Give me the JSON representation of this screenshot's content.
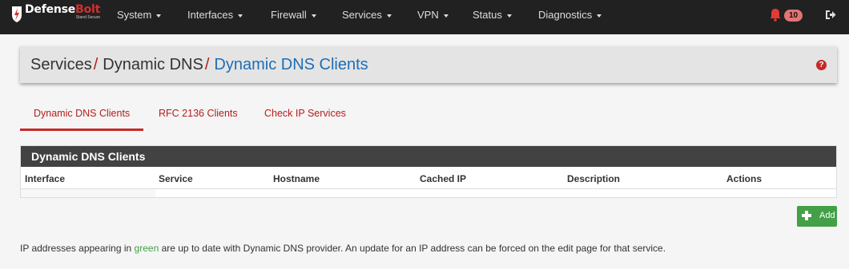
{
  "brand": {
    "word_main": "Defense",
    "word_accent": "Bolt",
    "tagline": "Stand Secure"
  },
  "nav": {
    "items": [
      "System",
      "Interfaces",
      "Firewall",
      "Services",
      "VPN",
      "Status",
      "Diagnostics"
    ],
    "notification_count": "10"
  },
  "breadcrumb": {
    "level1": "Services",
    "sep": "/",
    "level2": "Dynamic DNS",
    "current": "Dynamic DNS Clients",
    "help": "?"
  },
  "tabs": [
    "Dynamic DNS Clients",
    "RFC 2136 Clients",
    "Check IP Services"
  ],
  "panel": {
    "title": "Dynamic DNS Clients",
    "columns": [
      "Interface",
      "Service",
      "Hostname",
      "Cached IP",
      "Description",
      "Actions"
    ]
  },
  "add_button": {
    "label": "Add"
  },
  "info": {
    "before": "IP addresses appearing in ",
    "highlight": "green",
    "after": " are up to date with Dynamic DNS provider. An update for an IP address can be forced on the edit page for that service."
  },
  "colors": {
    "accent_red": "#c62828",
    "link_blue": "#1e6eb5",
    "success_green": "#43a047",
    "navbar": "#212121"
  }
}
